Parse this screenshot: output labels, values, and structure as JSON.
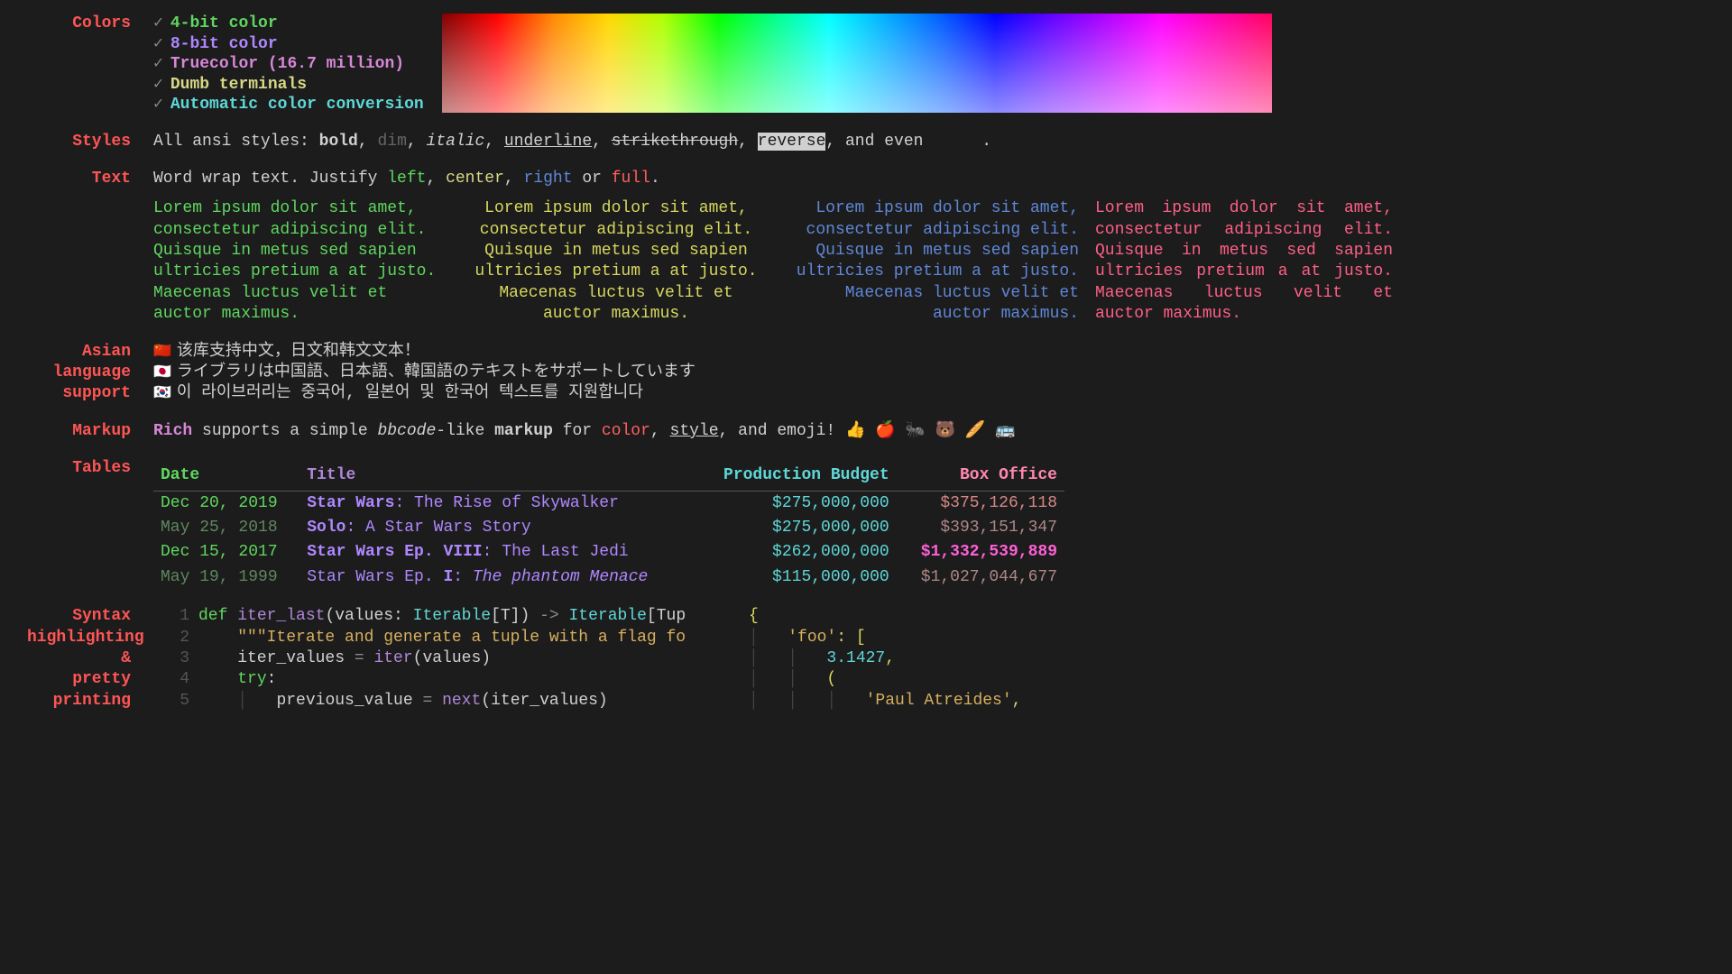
{
  "sections": {
    "colors_label": "Colors",
    "styles_label": "Styles",
    "text_label": "Text",
    "asian_label_1": "Asian",
    "asian_label_2": "language",
    "asian_label_3": "support",
    "markup_label": "Markup",
    "tables_label": "Tables",
    "syntax_label_1": "Syntax",
    "syntax_label_2": "highlighting",
    "syntax_label_3": "&",
    "syntax_label_4": "pretty",
    "syntax_label_5": "printing"
  },
  "colors": {
    "items": [
      {
        "label": "4-bit color",
        "class": "c-green"
      },
      {
        "label": "8-bit color",
        "class": "c-purple"
      },
      {
        "label": "Truecolor (16.7 million)",
        "class": "c-magenta"
      },
      {
        "label": "Dumb terminals",
        "class": "c-yellow"
      },
      {
        "label": "Automatic color conversion",
        "class": "c-cyan"
      }
    ],
    "check": "✓"
  },
  "styles": {
    "prefix": "All ansi styles: ",
    "bold": "bold",
    "dim": "dim",
    "italic": "italic",
    "underline": "underline",
    "strike": "strikethrough",
    "reverse": "reverse",
    "and_even": ", and even ",
    "period": "."
  },
  "text": {
    "prefix": "Word wrap text. Justify ",
    "left": "left",
    "center": "center",
    "right": "right",
    "or": " or ",
    "full": "full",
    "period": ".",
    "lorem": "Lorem ipsum dolor sit amet, consectetur adipiscing elit. Quisque in metus sed sapien ultricies pretium a at justo. Maecenas luctus velit et auctor maximus."
  },
  "asian": {
    "cn_flag": "🇨🇳",
    "cn_text": "该库支持中文，日文和韩文文本！",
    "jp_flag": "🇯🇵",
    "jp_text": "ライブラリは中国語、日本語、韓国語のテキストをサポートしています",
    "kr_flag": "🇰🇷",
    "kr_text": "이 라이브러리는 중국어, 일본어 및 한국어 텍스트를 지원합니다"
  },
  "markup": {
    "rich": "Rich",
    "p1": " supports a simple ",
    "bbcode": "bbcode",
    "p2": "-like ",
    "markup": "markup",
    "p3": " for ",
    "color": "color",
    "p4": ", ",
    "style": "style",
    "p5": ", and emoji! ",
    "emoji": "👍 🍎 🐜 🐻 🥖 🚌"
  },
  "table": {
    "headers": {
      "date": "Date",
      "title": "Title",
      "budget": "Production Budget",
      "box": "Box Office"
    },
    "rows": [
      {
        "date": "Dec 20, 2019",
        "date_cls": "c-green",
        "title_1": "Star Wars",
        "title_2": ": The Rise of Skywalker",
        "budget": "$275,000,000",
        "box": "$375,126,118",
        "box_cls": ""
      },
      {
        "date": "May 25, 2018",
        "date_cls": "c-dim",
        "title_1": "Solo",
        "title_2": ": A Star Wars Story",
        "title_dim": true,
        "budget": "$275,000,000",
        "box": "$393,151,347",
        "box_cls": ""
      },
      {
        "date": "Dec 15, 2017",
        "date_cls": "c-green",
        "title_1": "Star Wars Ep. VIII",
        "title_2": ": The Last Jedi",
        "budget": "$262,000,000",
        "box": "$1,332,539,889",
        "box_cls": "bold c-pink"
      },
      {
        "date": "May 19, 1999",
        "date_cls": "c-dim",
        "title_1": "Star Wars Ep. ",
        "title_i": "I",
        "title_2": ": ",
        "title_3": "The phantom Menace",
        "title_dim": true,
        "budget": "$115,000,000",
        "box": "$1,027,044,677",
        "box_cls": ""
      }
    ]
  },
  "syntax": {
    "lines": [
      {
        "n": "1",
        "tokens": [
          {
            "t": "def ",
            "c": "kw"
          },
          {
            "t": "iter_last",
            "c": "fn"
          },
          {
            "t": "(values: ",
            "c": ""
          },
          {
            "t": "Iterable",
            "c": "tp"
          },
          {
            "t": "[T]) ",
            "c": ""
          },
          {
            "t": "-> ",
            "c": "op"
          },
          {
            "t": "Iterable",
            "c": "tp"
          },
          {
            "t": "[Tup",
            "c": ""
          }
        ]
      },
      {
        "n": "2",
        "tokens": [
          {
            "t": "    ",
            "c": ""
          },
          {
            "t": "\"\"\"Iterate and generate a tuple with a flag fo",
            "c": "str"
          }
        ]
      },
      {
        "n": "3",
        "tokens": [
          {
            "t": "    iter_values ",
            "c": ""
          },
          {
            "t": "= ",
            "c": "op"
          },
          {
            "t": "iter",
            "c": "fn"
          },
          {
            "t": "(values)",
            "c": ""
          }
        ]
      },
      {
        "n": "4",
        "tokens": [
          {
            "t": "    ",
            "c": ""
          },
          {
            "t": "try",
            "c": "kw"
          },
          {
            "t": ":",
            "c": ""
          }
        ]
      },
      {
        "n": "5",
        "tokens": [
          {
            "t": "    ",
            "c": ""
          },
          {
            "t": "│   ",
            "c": "guide"
          },
          {
            "t": "previous_value ",
            "c": ""
          },
          {
            "t": "= ",
            "c": "op"
          },
          {
            "t": "next",
            "c": "fn"
          },
          {
            "t": "(iter_values)",
            "c": ""
          }
        ]
      }
    ],
    "pretty": [
      {
        "t": "{",
        "c": "br"
      },
      {
        "t": "│   'foo': [",
        "c": ""
      },
      {
        "t": "│   │   3.1427,",
        "c": ""
      },
      {
        "t": "│   │   (",
        "c": ""
      },
      {
        "t": "│   │   │   'Paul Atreides',",
        "c": ""
      }
    ]
  }
}
